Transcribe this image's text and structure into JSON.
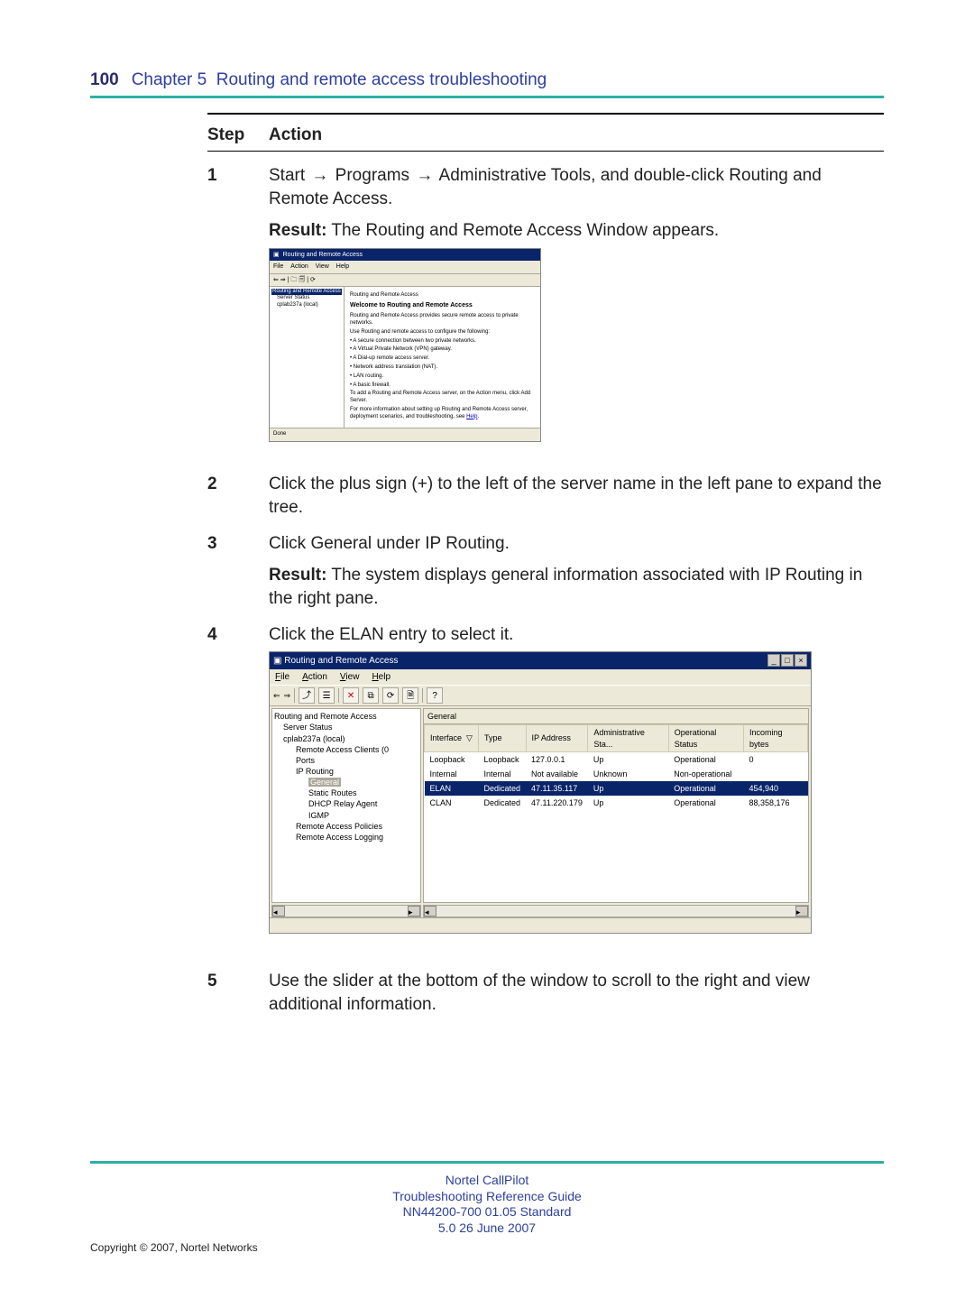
{
  "header": {
    "page_number": "100",
    "chapter": "Chapter 5",
    "title": "Routing and remote access troubleshooting"
  },
  "step_action": {
    "step": "Step",
    "action": "Action"
  },
  "steps": {
    "s1_num": "1",
    "s1_a": "Start ",
    "s1_b": " Programs ",
    "s1_c": " Administrative Tools, and double-click Routing and Remote Access.",
    "s1_result_label": "Result:",
    "s1_result_text": " The Routing and Remote Access Window appears.",
    "s2_num": "2",
    "s2_text": "Click the plus sign (+) to the left of the server name in the left pane to expand the tree.",
    "s3_num": "3",
    "s3_text": "Click General under IP Routing.",
    "s3_result_label": "Result:",
    "s3_result_text": " The system displays general information associated with IP Routing in the right pane.",
    "s4_num": "4",
    "s4_text": "Click the ELAN entry to select it.",
    "s5_num": "5",
    "s5_text": "Use the slider at the bottom of the window to scroll to the right and view additional information.",
    "arrow": "→"
  },
  "ss1": {
    "title": "Routing and Remote Access",
    "menu_file": "File",
    "menu_action": "Action",
    "menu_view": "View",
    "menu_help": "Help",
    "tree_root": "Routing and Remote Access",
    "tree_status": "Server Status",
    "tree_server": "cplab237a (local)",
    "pane_title": "Routing and Remote Access",
    "h": "Welcome to Routing and Remote Access",
    "p1": "Routing and Remote Access provides secure remote access to private networks.",
    "p2": "Use Routing and remote access to configure the following:",
    "b1": "• A secure connection between two private networks.",
    "b2": "• A Virtual Private Network (VPN) gateway.",
    "b3": "• A Dial-up remote access server.",
    "b4": "• Network address translation (NAT).",
    "b5": "• LAN routing.",
    "b6": "• A basic firewall.",
    "p3a": "To add a Routing and Remote Access server, on the Action menu, click Add Server.",
    "p4a": "For more information about setting up Routing and Remote Access server, deployment scenarios, and troubleshooting, see ",
    "p4b": "Help",
    "status": "Done"
  },
  "ss2": {
    "title": "Routing and Remote Access",
    "menu_file": "File",
    "menu_action": "Action",
    "menu_view": "View",
    "menu_help": "Help",
    "tree": {
      "root": "Routing and Remote Access",
      "status": "Server Status",
      "server": "cplab237a (local)",
      "rac": "Remote Access Clients (0",
      "ports": "Ports",
      "iprouting": "IP Routing",
      "general": "General",
      "static": "Static Routes",
      "dhcp": "DHCP Relay Agent",
      "igmp": "IGMP",
      "rap": "Remote Access Policies",
      "ral": "Remote Access Logging"
    },
    "cols": {
      "pane": "General",
      "c1": "Interface",
      "c2": "Type",
      "c3": "IP Address",
      "c4": "Administrative Sta...",
      "c5": "Operational Status",
      "c6": "Incoming bytes"
    },
    "rows": [
      {
        "iface": "Loopback",
        "type": "Loopback",
        "ip": "127.0.0.1",
        "admin": "Up",
        "op": "Operational",
        "bytes": "0"
      },
      {
        "iface": "Internal",
        "type": "Internal",
        "ip": "Not available",
        "admin": "Unknown",
        "op": "Non-operational",
        "bytes": ""
      },
      {
        "iface": "ELAN",
        "type": "Dedicated",
        "ip": "47.11.35.117",
        "admin": "Up",
        "op": "Operational",
        "bytes": "454,940"
      },
      {
        "iface": "CLAN",
        "type": "Dedicated",
        "ip": "47.11.220.179",
        "admin": "Up",
        "op": "Operational",
        "bytes": "88,358,176"
      }
    ]
  },
  "footer": {
    "l1": "Nortel CallPilot",
    "l2": "Troubleshooting Reference Guide",
    "l3": "NN44200-700   01.05   Standard",
    "l4": "5.0   26 June 2007",
    "copy": "Copyright © 2007, Nortel Networks"
  }
}
